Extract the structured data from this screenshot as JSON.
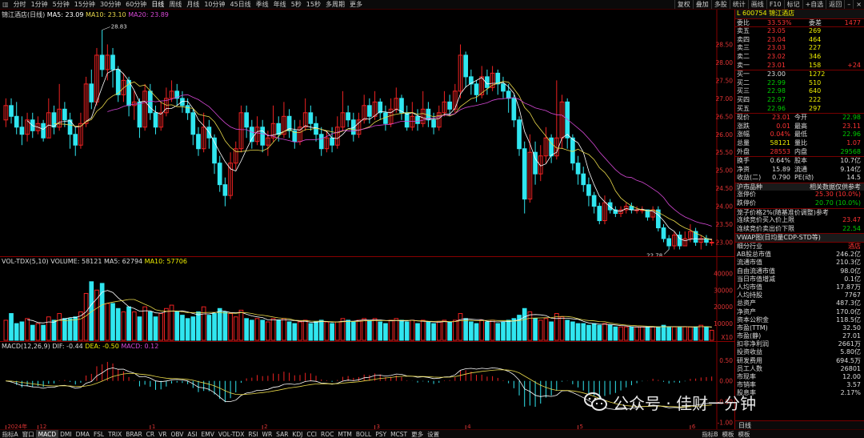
{
  "topbar": {
    "stock_name": "锦江酒店",
    "periods": [
      "分时",
      "1分钟",
      "5分钟",
      "15分钟",
      "30分钟",
      "60分钟",
      "日线",
      "周线",
      "月线",
      "10分钟",
      "45日线",
      "季线",
      "年线",
      "5秒",
      "15秒",
      "多周期",
      "更多"
    ],
    "active_period": "日线",
    "tools": [
      "复权",
      "叠加",
      "多股",
      "统计",
      "画线",
      "F10",
      "标记",
      "+自选",
      "返回"
    ]
  },
  "main_panel": {
    "title": "锦江酒店(日线)",
    "ma5_label": "MA5: 23.09",
    "ma10_label": "MA10: 23.10",
    "ma20_label": "MA20: 23.89",
    "yaxis": [
      "28.50",
      "28.00",
      "27.50",
      "27.00",
      "26.50",
      "26.00",
      "25.50",
      "25.00",
      "24.50",
      "24.00",
      "23.50",
      "23.00"
    ],
    "high_label": "28.83",
    "low_label": "22.78",
    "colors": {
      "up": "#ee2222",
      "down": "#30e6f0",
      "ma5": "#ffffff",
      "ma10": "#e8d84a",
      "ma20": "#d548d5"
    }
  },
  "vol_panel": {
    "title": "VOL-TDX(5,10)",
    "volume_label": "VOLUME: 58121",
    "ma5_label": "MA5: 62794",
    "ma10_label": "MA10: 57706",
    "yaxis": [
      "40000",
      "30000",
      "20000",
      "10000"
    ],
    "unit": "X10"
  },
  "macd_panel": {
    "title": "MACD(12,26,9)",
    "dif_label": "DIF: -0.44",
    "dea_label": "DEA: -0.50",
    "macd_label": "MACD: 0.12",
    "yaxis": [
      "0.50",
      "0.00",
      "-0.50",
      "-1.00"
    ]
  },
  "xaxis": {
    "labels": [
      "2024年",
      "12",
      "1",
      "2",
      "3",
      "4",
      "5",
      "6"
    ]
  },
  "chart_data": {
    "type": "candlestick",
    "title": "锦江酒店(日线)",
    "ylim": [
      22.7,
      29.2
    ],
    "candles": [
      [
        26.4,
        26.8,
        27.0,
        26.2
      ],
      [
        26.8,
        26.5,
        27.0,
        26.3
      ],
      [
        26.5,
        26.2,
        26.9,
        26.0
      ],
      [
        26.2,
        26.0,
        26.5,
        25.7
      ],
      [
        26.0,
        26.4,
        26.6,
        25.8
      ],
      [
        26.4,
        26.1,
        26.6,
        25.9
      ],
      [
        26.1,
        26.3,
        26.5,
        26.0
      ],
      [
        26.3,
        25.9,
        26.4,
        25.8
      ],
      [
        25.9,
        26.6,
        27.0,
        25.9
      ],
      [
        26.6,
        26.2,
        26.8,
        26.0
      ],
      [
        26.2,
        26.7,
        27.4,
        26.1
      ],
      [
        26.7,
        26.4,
        26.9,
        26.2
      ],
      [
        26.4,
        26.0,
        26.6,
        25.6
      ],
      [
        26.0,
        25.7,
        26.2,
        25.4
      ],
      [
        25.7,
        26.3,
        26.6,
        25.6
      ],
      [
        26.3,
        27.4,
        27.6,
        26.2
      ],
      [
        27.4,
        26.9,
        27.8,
        26.7
      ],
      [
        26.9,
        28.2,
        28.4,
        26.8
      ],
      [
        28.2,
        27.8,
        28.9,
        27.6
      ],
      [
        27.8,
        28.2,
        28.5,
        27.5
      ],
      [
        28.2,
        27.8,
        28.4,
        27.3
      ],
      [
        27.8,
        27.1,
        27.9,
        26.9
      ],
      [
        27.1,
        27.5,
        27.7,
        26.9
      ],
      [
        27.5,
        26.8,
        27.6,
        26.5
      ],
      [
        26.8,
        26.9,
        27.2,
        26.4
      ],
      [
        26.9,
        26.2,
        27.0,
        25.9
      ],
      [
        26.2,
        27.2,
        27.4,
        26.1
      ],
      [
        27.2,
        26.6,
        27.4,
        26.4
      ],
      [
        26.6,
        26.2,
        26.8,
        26.0
      ],
      [
        26.2,
        26.6,
        26.9,
        26.1
      ],
      [
        26.6,
        27.0,
        27.3,
        26.5
      ],
      [
        27.0,
        27.2,
        27.5,
        26.9
      ],
      [
        27.2,
        27.0,
        27.4,
        26.8
      ],
      [
        27.0,
        26.8,
        27.2,
        26.6
      ],
      [
        26.8,
        26.6,
        27.0,
        26.4
      ],
      [
        26.6,
        26.0,
        26.7,
        25.7
      ],
      [
        26.0,
        25.6,
        26.2,
        25.4
      ],
      [
        25.6,
        26.2,
        26.6,
        25.5
      ],
      [
        26.2,
        25.9,
        26.4,
        25.6
      ],
      [
        25.9,
        25.2,
        26.0,
        24.9
      ],
      [
        25.2,
        24.6,
        25.4,
        24.4
      ],
      [
        24.6,
        24.3,
        24.8,
        24.0
      ],
      [
        24.3,
        25.2,
        25.5,
        24.2
      ],
      [
        25.2,
        25.6,
        25.8,
        25.0
      ],
      [
        25.6,
        26.6,
        26.8,
        25.5
      ],
      [
        26.6,
        26.2,
        26.8,
        25.9
      ],
      [
        26.2,
        25.8,
        26.4,
        25.6
      ],
      [
        25.8,
        26.2,
        26.5,
        25.7
      ],
      [
        26.2,
        25.7,
        26.4,
        25.5
      ],
      [
        25.7,
        25.9,
        26.1,
        25.4
      ],
      [
        25.9,
        26.3,
        26.8,
        25.8
      ],
      [
        26.3,
        26.0,
        26.5,
        25.8
      ],
      [
        26.0,
        26.5,
        26.9,
        25.9
      ],
      [
        26.5,
        26.1,
        26.7,
        25.9
      ],
      [
        26.1,
        25.8,
        26.4,
        25.6
      ],
      [
        25.8,
        26.2,
        26.4,
        25.7
      ],
      [
        26.2,
        26.6,
        27.0,
        26.1
      ],
      [
        26.6,
        26.3,
        26.8,
        26.1
      ],
      [
        26.3,
        26.0,
        26.5,
        25.8
      ],
      [
        26.0,
        25.6,
        26.2,
        25.4
      ],
      [
        25.6,
        25.9,
        26.1,
        25.5
      ],
      [
        25.9,
        25.7,
        26.2,
        25.5
      ],
      [
        25.7,
        26.2,
        26.5,
        25.6
      ],
      [
        26.2,
        26.6,
        27.2,
        26.1
      ],
      [
        26.6,
        26.4,
        26.8,
        26.2
      ],
      [
        26.4,
        26.0,
        26.6,
        25.8
      ],
      [
        26.0,
        26.4,
        26.6,
        25.9
      ],
      [
        26.4,
        26.8,
        27.1,
        26.3
      ],
      [
        26.8,
        26.5,
        27.0,
        26.3
      ],
      [
        26.5,
        26.9,
        27.2,
        26.4
      ],
      [
        26.9,
        26.6,
        27.0,
        26.4
      ],
      [
        26.6,
        26.3,
        26.8,
        26.1
      ],
      [
        26.3,
        26.7,
        27.0,
        26.2
      ],
      [
        26.7,
        27.0,
        27.3,
        26.6
      ],
      [
        27.0,
        26.6,
        27.1,
        26.4
      ],
      [
        26.6,
        26.2,
        26.8,
        26.1
      ],
      [
        26.2,
        26.5,
        26.9,
        26.1
      ],
      [
        26.5,
        26.3,
        26.7,
        26.1
      ],
      [
        26.3,
        26.7,
        27.2,
        26.2
      ],
      [
        26.7,
        26.4,
        26.9,
        26.2
      ],
      [
        26.4,
        26.2,
        26.6,
        26.0
      ],
      [
        26.2,
        26.6,
        26.8,
        26.1
      ],
      [
        26.6,
        26.9,
        27.2,
        26.5
      ],
      [
        26.9,
        26.7,
        27.1,
        26.5
      ],
      [
        26.7,
        27.2,
        27.4,
        26.6
      ],
      [
        27.2,
        28.2,
        28.5,
        27.0
      ],
      [
        28.2,
        27.6,
        28.3,
        27.3
      ],
      [
        27.6,
        27.4,
        27.8,
        27.1
      ],
      [
        27.4,
        27.1,
        27.5,
        26.9
      ],
      [
        27.1,
        27.6,
        27.9,
        27.0
      ],
      [
        27.6,
        27.3,
        27.8,
        27.1
      ],
      [
        27.3,
        27.7,
        27.9,
        27.2
      ],
      [
        27.7,
        27.4,
        27.8,
        27.1
      ],
      [
        27.4,
        27.2,
        27.6,
        27.0
      ],
      [
        27.2,
        27.0,
        27.4,
        26.6
      ],
      [
        27.0,
        26.4,
        27.1,
        26.2
      ],
      [
        26.4,
        25.6,
        26.5,
        25.4
      ],
      [
        25.6,
        24.2,
        25.8,
        23.8
      ],
      [
        24.2,
        25.5,
        26.0,
        24.1
      ],
      [
        25.5,
        24.9,
        25.8,
        24.6
      ],
      [
        24.9,
        25.4,
        25.7,
        24.7
      ],
      [
        25.4,
        25.9,
        26.2,
        25.2
      ],
      [
        25.9,
        25.4,
        26.0,
        25.2
      ],
      [
        25.4,
        25.9,
        27.5,
        25.3
      ],
      [
        25.9,
        26.9,
        27.1,
        25.6
      ],
      [
        26.9,
        25.9,
        27.0,
        25.6
      ],
      [
        25.9,
        25.2,
        26.0,
        25.0
      ],
      [
        25.2,
        24.9,
        25.4,
        24.6
      ],
      [
        24.9,
        24.6,
        25.1,
        24.4
      ],
      [
        24.6,
        24.3,
        24.8,
        24.0
      ],
      [
        24.3,
        24.0,
        24.4,
        23.8
      ],
      [
        24.0,
        23.6,
        24.1,
        23.5
      ],
      [
        23.6,
        24.1,
        24.3,
        23.5
      ],
      [
        24.1,
        23.9,
        24.2,
        23.8
      ],
      [
        23.9,
        23.8,
        24.0,
        23.7
      ],
      [
        23.8,
        23.9,
        24.0,
        23.7
      ],
      [
        23.9,
        24.0,
        24.1,
        23.8
      ],
      [
        24.0,
        23.9,
        24.1,
        23.8
      ],
      [
        23.9,
        23.9,
        24.0,
        23.8
      ],
      [
        23.9,
        23.9,
        24.0,
        23.8
      ],
      [
        23.9,
        23.7,
        23.9,
        23.6
      ],
      [
        23.7,
        23.9,
        24.0,
        23.6
      ],
      [
        23.9,
        23.4,
        24.0,
        23.3
      ],
      [
        23.4,
        23.1,
        23.5,
        23.0
      ],
      [
        23.1,
        22.9,
        23.2,
        22.8
      ],
      [
        22.9,
        23.2,
        23.3,
        22.8
      ],
      [
        23.2,
        22.9,
        23.3,
        22.8
      ],
      [
        22.9,
        23.1,
        23.3,
        22.9
      ],
      [
        23.1,
        23.3,
        23.5,
        23.0
      ],
      [
        23.3,
        23.0,
        23.4,
        22.9
      ],
      [
        23.0,
        23.1,
        23.2,
        22.8
      ],
      [
        23.1,
        23.0,
        23.2,
        22.9
      ],
      [
        23.0,
        23.0,
        23.1,
        22.9
      ]
    ],
    "volume": [
      12,
      16,
      10,
      11,
      13,
      9,
      10,
      9,
      14,
      12,
      16,
      13,
      13,
      14,
      17,
      28,
      35,
      30,
      34,
      22,
      22,
      19,
      17,
      20,
      17,
      14,
      20,
      17,
      14,
      16,
      19,
      21,
      17,
      15,
      13,
      14,
      17,
      20,
      15,
      16,
      19,
      17,
      16,
      14,
      18,
      13,
      12,
      13,
      12,
      11,
      13,
      12,
      13,
      11,
      10,
      11,
      12,
      10,
      11,
      12,
      11,
      10,
      11,
      13,
      12,
      11,
      12,
      13,
      12,
      13,
      11,
      10,
      12,
      13,
      12,
      11,
      12,
      10,
      12,
      11,
      10,
      11,
      12,
      11,
      12,
      16,
      13,
      11,
      10,
      12,
      11,
      12,
      10,
      11,
      12,
      13,
      15,
      19,
      17,
      13,
      12,
      13,
      11,
      16,
      14,
      12,
      11,
      10,
      10,
      9,
      10,
      9,
      10,
      9,
      8,
      8,
      8,
      8,
      8,
      8,
      8,
      8,
      8,
      9,
      8,
      8,
      8,
      8,
      8,
      8,
      9,
      8,
      6
    ],
    "vol_unit": "X10",
    "vol_ylim": [
      0,
      44000
    ],
    "macd_ylim": [
      -1.15,
      0.75
    ],
    "ma5_last": 23.09,
    "ma10_last": 23.1,
    "ma20_last": 23.89,
    "volume_last": 58121,
    "vol_ma5_last": 62794,
    "vol_ma10_last": 57706,
    "dif_last": -0.44,
    "dea_last": -0.5,
    "macd_last": 0.12
  },
  "quote_panel": {
    "code_label": "L 600754 锦江酒店",
    "weibi": {
      "label": "委比",
      "value": "33.53%",
      "label2": "委差",
      "value2": "1477"
    },
    "sell": [
      {
        "label": "卖五",
        "price": "23.05",
        "vol": "269"
      },
      {
        "label": "卖四",
        "price": "23.04",
        "vol": "464"
      },
      {
        "label": "卖三",
        "price": "23.03",
        "vol": "227"
      },
      {
        "label": "卖二",
        "price": "23.02",
        "vol": "346"
      },
      {
        "label": "卖一",
        "price": "23.01",
        "vol": "158",
        "chg": "+24"
      }
    ],
    "buy": [
      {
        "label": "买一",
        "price": "23.00",
        "vol": "1272"
      },
      {
        "label": "买二",
        "price": "22.99",
        "vol": "510"
      },
      {
        "label": "买三",
        "price": "22.98",
        "vol": "640"
      },
      {
        "label": "买四",
        "price": "22.97",
        "vol": "222"
      },
      {
        "label": "买五",
        "price": "22.96",
        "vol": "297"
      }
    ],
    "stats": [
      {
        "l1": "现价",
        "v1": "23.01",
        "l2": "今开",
        "v2": "22.98"
      },
      {
        "l1": "涨跌",
        "v1": "0.01",
        "l2": "最高",
        "v2": "23.11"
      },
      {
        "l1": "涨幅",
        "v1": "0.04%",
        "l2": "最低",
        "v2": "22.96"
      },
      {
        "l1": "总量",
        "v1": "58121",
        "l2": "量比",
        "v2": "1.07"
      },
      {
        "l1": "外盘",
        "v1": "28553",
        "l2": "内盘",
        "v2": "29568"
      }
    ],
    "stats2": [
      {
        "l1": "换手",
        "v1": "0.64%",
        "l2": "股本",
        "v2": "10.7亿"
      },
      {
        "l1": "净资",
        "v1": "15.89",
        "l2": "流通",
        "v2": "9.14亿"
      },
      {
        "l1": "收益(二)",
        "v1": "0.790",
        "l2": "PE(动)",
        "v2": "14.5"
      }
    ],
    "market_label": "沪市品种",
    "market_note": "相关数据仅供参考",
    "limit_up": {
      "label": "涨停价",
      "value": "25.30 (10.0%)"
    },
    "limit_down": {
      "label": "跌停价",
      "value": "20.70 (10.0%)"
    },
    "band_label": "笼子价格2%(随基准价调整)参考",
    "auction_buy": {
      "label": "连续竞价买入价上限",
      "value": "23.47"
    },
    "auction_sell": {
      "label": "连续竞价卖出价下限",
      "value": "22.54"
    },
    "vwap_label": "VWAP图(日均量CDP-STD等)",
    "fund": [
      {
        "label": "细分行业",
        "value": "酒店"
      },
      {
        "label": "AB股总市值",
        "value": "246.2亿"
      },
      {
        "label": "流通市值",
        "value": "210.3亿"
      },
      {
        "label": "自由流通市值",
        "value": "98.0亿"
      },
      {
        "label": "当日市值增减",
        "value": "0.1亿"
      },
      {
        "label": "人均市值",
        "value": "17.87万"
      },
      {
        "label": "人均持股",
        "value": "7767"
      },
      {
        "label": "总资产",
        "value": "487.3亿"
      },
      {
        "label": "净资产",
        "value": "170.0亿"
      },
      {
        "label": "资本公积金",
        "value": "118.5亿"
      },
      {
        "label": "市盈(TTM)",
        "value": "32.50"
      },
      {
        "label": "市盈(静)",
        "value": "27.01"
      },
      {
        "label": "扣非净利润",
        "value": "2661万"
      },
      {
        "label": "投资收益",
        "value": "5.80亿"
      },
      {
        "label": "研发费用",
        "value": "694.5万"
      },
      {
        "label": "员工人数",
        "value": "26801"
      },
      {
        "label": "市现率",
        "value": "12.00"
      },
      {
        "label": "市销率",
        "value": "3.57"
      },
      {
        "label": "股息率",
        "value": "2.17%"
      }
    ],
    "day_tab": "日线"
  },
  "bottombar": {
    "left_tabs": [
      "指标A",
      "窗口",
      "MACD",
      "DMI",
      "DMA",
      "FSL",
      "TRIX",
      "BRAR",
      "CR",
      "VR",
      "OBV",
      "ASI",
      "EMV",
      "VOL-TDX",
      "RSI",
      "WR",
      "SAR",
      "KDJ",
      "CCI",
      "ROC",
      "MTM",
      "BOLL",
      "PSY",
      "MCST",
      "更多",
      "设置"
    ],
    "active_tab": "MACD",
    "right_tabs": [
      "指标B",
      "模板",
      "模板"
    ]
  },
  "watermark": {
    "text": "公众号 · 佳财一分钟"
  }
}
